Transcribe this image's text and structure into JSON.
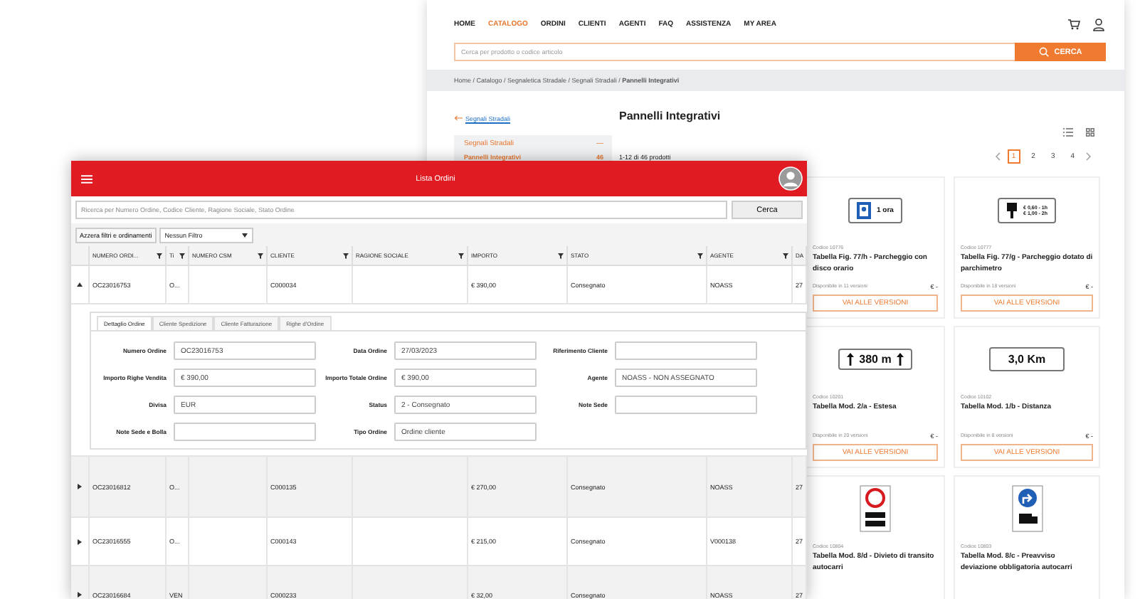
{
  "catalog_site": {
    "nav": [
      {
        "label": "HOME",
        "selected": false
      },
      {
        "label": "CATALOGO",
        "selected": true
      },
      {
        "label": "ORDINI",
        "selected": false
      },
      {
        "label": "CLIENTI",
        "selected": false
      },
      {
        "label": "AGENTI",
        "selected": false
      },
      {
        "label": "FAQ",
        "selected": false
      },
      {
        "label": "ASSISTENZA",
        "selected": false
      },
      {
        "label": "MY AREA",
        "selected": false
      }
    ],
    "search": {
      "placeholder": "Cerca per prodotto o codice articolo",
      "button": "CERCA"
    },
    "breadcrumb": "Home / Catalogo / Segnaletica Stradale / Segnali Stradali / **Pannelli Integrativi**",
    "back_link": "Segnali Stradali",
    "sidebar": {
      "title": "Segnali Stradali",
      "toggle": "—",
      "items": [
        {
          "label": "Pannelli Integrativi",
          "count": "46",
          "selected": true
        }
      ]
    },
    "page_title": "Pannelli Integrativi",
    "results_count": "1-12 di 46 prodotti",
    "pages": [
      {
        "label": "1",
        "selected": true
      },
      {
        "label": "2",
        "selected": false
      },
      {
        "label": "3",
        "selected": false
      },
      {
        "label": "4",
        "selected": false
      }
    ],
    "products": [
      {
        "code": "Codice 10776",
        "title": "Tabella Fig. 77/h - Parcheggio con disco orario",
        "availability": "Disponibile in 11 versioni",
        "price": "€ -",
        "button": "VAI ALLE VERSIONI",
        "sign": {
          "kind": "parking",
          "texts": [
            "1 ora"
          ]
        }
      },
      {
        "code": "Codice 10777",
        "title": "Tabella Fig. 77/g - Parcheggio dotato di parchimetro",
        "availability": "Disponibile in 18 versioni",
        "price": "€ -",
        "button": "VAI ALLE VERSIONI",
        "sign": {
          "kind": "meter",
          "texts": [
            "€ 0,60 - 1h",
            "€ 1,00 - 2h"
          ]
        }
      },
      {
        "code": "Codice 10201",
        "title": "Tabella Mod. 2/a - Estesa",
        "availability": "Disponibile in 20 versioni",
        "price": "€ -",
        "button": "VAI ALLE VERSIONI",
        "sign": {
          "kind": "arrows",
          "texts": [
            "380 m"
          ]
        }
      },
      {
        "code": "Codice 10102",
        "title": "Tabella Mod. 1/b - Distanza",
        "availability": "Disponibile in 8 versioni",
        "price": "€ -",
        "button": "VAI ALLE VERSIONI",
        "sign": {
          "kind": "plain",
          "texts": [
            "3,0 Km"
          ]
        }
      },
      {
        "code": "Codice 10804",
        "title": "Tabella Mod. 8/d - Divieto di transito autocarri",
        "sign": {
          "kind": "prohibition"
        }
      },
      {
        "code": "Codice 10803",
        "title": "Tabella Mod. 8/c - Preavviso deviazione obbligatoria autocarri",
        "sign": {
          "kind": "direction"
        }
      }
    ]
  },
  "orders_app": {
    "title": "Lista Ordini",
    "search": {
      "placeholder": "Ricerca per Numero Ordine, Codice Cliente, Ragione Sociale, Stato Ordine",
      "button": "Cerca"
    },
    "reset_button": "Azzera filtri e ordinamenti",
    "filter_select": "Nessun Filtro",
    "columns": [
      {
        "label": "NUMERO ORDI...",
        "filterable": true
      },
      {
        "label": "Ti",
        "filterable": true
      },
      {
        "label": "NUMERO CSM",
        "filterable": true
      },
      {
        "label": "CLIENTE",
        "filterable": true
      },
      {
        "label": "RAGIONE SOCIALE",
        "filterable": true
      },
      {
        "label": "IMPORTO",
        "filterable": true
      },
      {
        "label": "STATO",
        "filterable": true
      },
      {
        "label": "AGENTE",
        "filterable": true
      },
      {
        "label": "DA"
      }
    ],
    "rows": [
      {
        "expanded": true,
        "cells": [
          "OC23016753",
          "O...",
          "",
          "C000034",
          "",
          "€ 390,00",
          "Consegnato",
          "NOASS",
          "27"
        ],
        "detail": {
          "tabs": [
            {
              "label": "Dettaglio Ordine",
              "selected": true
            },
            {
              "label": "Cliente Spedizione",
              "selected": false
            },
            {
              "label": "Cliente Fatturazione",
              "selected": false
            },
            {
              "label": "Righe d'Ordine",
              "selected": false
            }
          ],
          "fields": [
            {
              "label": "Numero Ordine",
              "value": "OC23016753"
            },
            {
              "label": "Data Ordine",
              "value": "27/03/2023"
            },
            {
              "label": "Riferimento Cliente"
            },
            {
              "label": "Importo Righe Vendita",
              "value": "€ 390,00"
            },
            {
              "label": "Importo Totale Ordine",
              "value": "€ 390,00"
            },
            {
              "label": "Agente",
              "value": "NOASS - NON ASSEGNATO"
            },
            {
              "label": "Divisa",
              "value": "EUR"
            },
            {
              "label": "Status",
              "value": "2 - Consegnato"
            },
            {
              "label": "Note Sede"
            },
            {
              "label": "Note Sede e Bolla"
            },
            {
              "label": "Tipo Ordine",
              "value": "Ordine cliente"
            }
          ]
        }
      },
      {
        "expanded": false,
        "cells": [
          "OC23016812",
          "O...",
          "",
          "C000135",
          "",
          "€ 270,00",
          "Consegnato",
          "NOASS",
          "27"
        ]
      },
      {
        "expanded": false,
        "cells": [
          "OC23016555",
          "O...",
          "",
          "C000143",
          "",
          "€ 215,00",
          "Consegnato",
          "V000138",
          "27"
        ]
      },
      {
        "expanded": false,
        "cells": [
          "OC23016684",
          "VEN",
          "",
          "C000233",
          "",
          "€ 32,00",
          "Consegnato",
          "NOASS",
          "27"
        ]
      }
    ]
  }
}
